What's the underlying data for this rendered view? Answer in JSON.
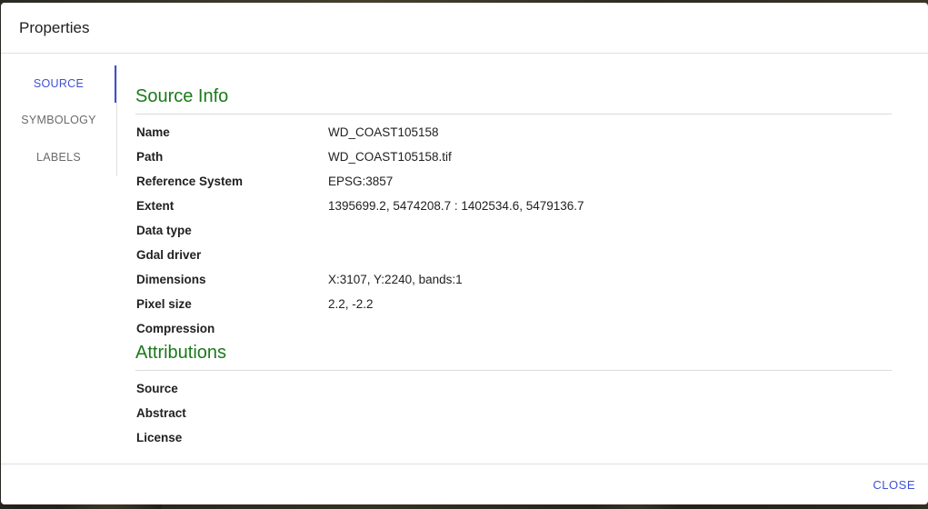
{
  "dialog": {
    "title": "Properties",
    "close_label": "CLOSE"
  },
  "tabs": [
    {
      "label": "SOURCE",
      "active": true
    },
    {
      "label": "SYMBOLOGY",
      "active": false
    },
    {
      "label": "LABELS",
      "active": false
    }
  ],
  "source_info": {
    "title": "Source Info",
    "rows": [
      {
        "label": "Name",
        "value": "WD_COAST105158"
      },
      {
        "label": "Path",
        "value": "WD_COAST105158.tif"
      },
      {
        "label": "Reference System",
        "value": "EPSG:3857"
      },
      {
        "label": "Extent",
        "value": "1395699.2, 5474208.7 : 1402534.6, 5479136.7"
      },
      {
        "label": "Data type",
        "value": ""
      },
      {
        "label": "Gdal driver",
        "value": ""
      },
      {
        "label": "Dimensions",
        "value": "X:3107, Y:2240, bands:1"
      },
      {
        "label": "Pixel size",
        "value": "2.2, -2.2"
      },
      {
        "label": "Compression",
        "value": ""
      }
    ]
  },
  "attributions": {
    "title": "Attributions",
    "rows": [
      {
        "label": "Source",
        "value": ""
      },
      {
        "label": "Abstract",
        "value": ""
      },
      {
        "label": "License",
        "value": ""
      }
    ]
  },
  "colors": {
    "accent": "#3f51d4",
    "section_title": "#1a7a1a"
  }
}
